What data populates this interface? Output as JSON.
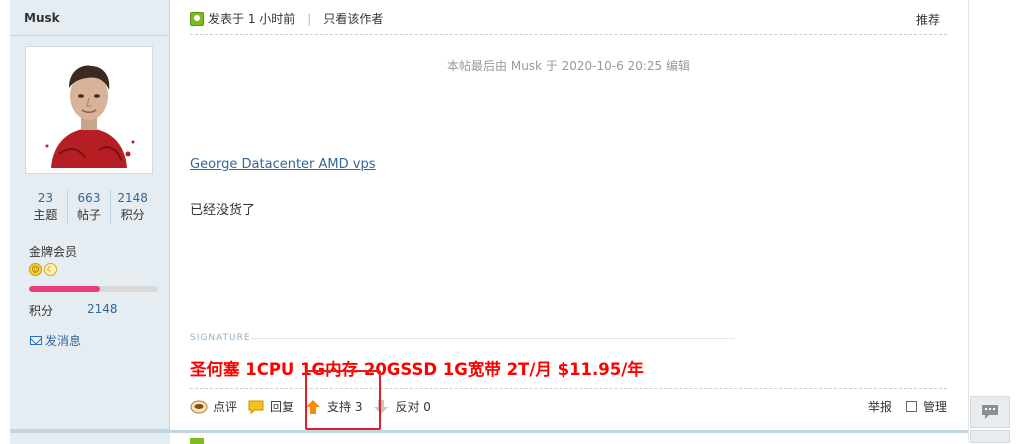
{
  "author": {
    "name": "Musk",
    "stats": [
      {
        "value": "23",
        "label": "主题"
      },
      {
        "value": "663",
        "label": "帖子"
      },
      {
        "value": "2148",
        "label": "积分"
      }
    ],
    "group": "金牌会员",
    "level_progress": 0.55,
    "credit_label": "积分",
    "credit_value": "2148",
    "send_message": "发消息"
  },
  "post": {
    "posted_time": "发表于 1 小时前",
    "only_author": "只看该作者",
    "recommend": "推荐",
    "edit_note": "本帖最后由 Musk 于 2020-10-6 20:25 编辑",
    "link_text": "George Datacenter AMD vps",
    "body_text": "已经没货了",
    "signature_label": "SIGNATURE",
    "signature_text": "圣何塞 1CPU 1G内存 20GSSD 1G宽带 2T/月 $11.95/年"
  },
  "actions": {
    "comment": "点评",
    "reply": "回复",
    "support": "支持 3",
    "oppose": "反对 0",
    "report": "举报",
    "manage": "管理"
  },
  "colors": {
    "accent_blue": "#336699",
    "signature_red": "#ff0000",
    "highlight_red": "#e02020",
    "sidebar_bg": "#e5edf2"
  }
}
